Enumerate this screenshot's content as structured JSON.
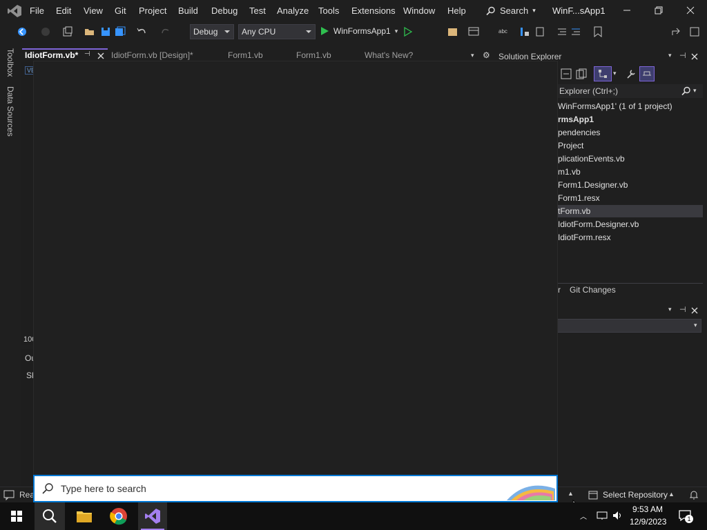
{
  "menu": {
    "items": [
      "File",
      "Edit",
      "View",
      "Git",
      "Project",
      "Build",
      "Debug",
      "Test",
      "Analyze",
      "Tools",
      "Extensions",
      "Window",
      "Help"
    ],
    "search_label": "Search",
    "window_title": "WinF...sApp1"
  },
  "toolbar": {
    "config": "Debug",
    "platform": "Any CPU",
    "run_target": "WinFormsApp1"
  },
  "left_strip": {
    "toolbox": "Toolbox",
    "data_sources": "Data Sources"
  },
  "doc_tabs": {
    "active": "IdiotForm.vb*",
    "tab2": "IdiotForm.vb [Design]*",
    "tab3": "Form1.vb",
    "tab4": "Form1.vb",
    "tab5": "What's New?"
  },
  "editor": {
    "vb_badge": "VB",
    "zoom": "100",
    "output_label": "Ou",
    "show_label": "Sh"
  },
  "solution_explorer": {
    "title": "Solution Explorer",
    "search_placeholder": "Explorer (Ctrl+;)",
    "items": [
      "WinFormsApp1' (1 of 1 project)",
      "rmsApp1",
      "pendencies",
      "Project",
      "plicationEvents.vb",
      "m1.vb",
      "Form1.Designer.vb",
      "Form1.resx",
      "tForm.vb",
      "IdiotForm.Designer.vb",
      "IdiotForm.resx"
    ],
    "bottom_tab_partial": "r",
    "git_changes": "Git Changes"
  },
  "status": {
    "ready_partial": "Rea",
    "select_repo": "Select Repository"
  },
  "start_search": {
    "placeholder": "Type here to search"
  },
  "taskbar": {
    "time": "9:53 AM",
    "date": "12/9/2023",
    "notification_count": "1"
  },
  "colors": {
    "accent_purple": "#7f65d9",
    "search_border": "#0078d4",
    "run_green": "#2fbf4f"
  }
}
